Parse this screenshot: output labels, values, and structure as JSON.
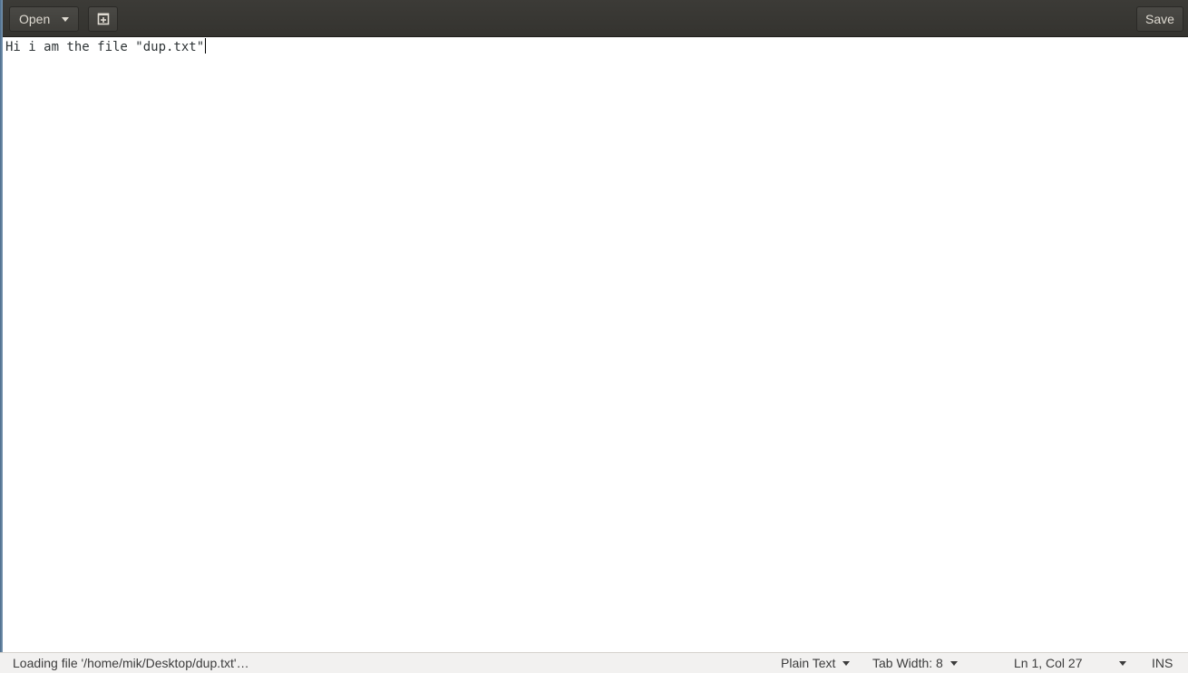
{
  "headerbar": {
    "open_label": "Open",
    "new_tab_icon": "new-document-icon",
    "save_label": "Save"
  },
  "editor": {
    "content": "Hi i am the file \"dup.txt\""
  },
  "statusbar": {
    "message": "Loading file '/home/mik/Desktop/dup.txt'…",
    "language": "Plain Text",
    "tab_width": "Tab Width: 8",
    "position": "Ln 1, Col 27",
    "mode": "INS"
  },
  "colors": {
    "headerbar_bg": "#3c3b37",
    "headerbar_text": "#dfdbd2",
    "statusbar_bg": "#f2f1f0",
    "editor_text": "#2e3436"
  }
}
